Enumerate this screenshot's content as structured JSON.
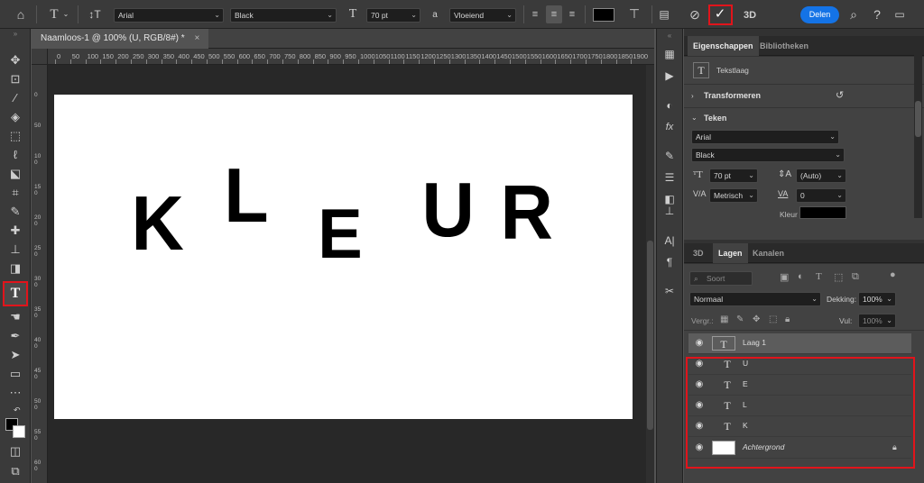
{
  "options_bar": {
    "font_family": "Arial",
    "font_style": "Black",
    "font_size": "70 pt",
    "aa_label": "a",
    "anti_alias": "Vloeiend",
    "text_color": "#000000",
    "threed_label": "3D",
    "share_label": "Delen"
  },
  "document": {
    "tab_title": "Naamloos-1 @ 100% (U, RGB/8#) *",
    "close_glyph": "×",
    "ruler_h": [
      "0",
      "50",
      "100",
      "150",
      "200",
      "250",
      "300",
      "350",
      "400",
      "450",
      "500",
      "550",
      "600",
      "650",
      "700",
      "750",
      "800",
      "850",
      "900",
      "950",
      "1000",
      "1050",
      "1100",
      "1150",
      "1200",
      "1250",
      "1300",
      "1350",
      "1400",
      "1450",
      "1500",
      "1550",
      "1600",
      "1650",
      "1700",
      "1750",
      "1800",
      "1850",
      "1900"
    ],
    "ruler_v": [
      "0",
      "50",
      "100",
      "150",
      "200",
      "250",
      "300",
      "350",
      "400",
      "450",
      "500",
      "550",
      "600",
      "650",
      "700",
      "750",
      "800",
      "850",
      "900",
      "950",
      "1000"
    ],
    "letters": [
      "K",
      "L",
      "E",
      "U",
      "R"
    ]
  },
  "properties": {
    "tabs": [
      "Eigenschappen",
      "Bibliotheken"
    ],
    "layer_type": "Tekstlaag",
    "transform_label": "Transformeren",
    "teken_label": "Teken",
    "font_family": "Arial",
    "font_style": "Black",
    "size": "70 pt",
    "leading": "(Auto)",
    "kerning": "Metrisch",
    "tracking": "0",
    "color_label": "Kleur",
    "color": "#000000"
  },
  "layers_panel": {
    "tabs": [
      "3D",
      "Lagen",
      "Kanalen"
    ],
    "search_placeholder": "Soort",
    "blend_mode": "Normaal",
    "opacity_label": "Dekking:",
    "opacity": "100%",
    "lock_label": "Vergr.:",
    "fill_label": "Vul:",
    "fill": "100%",
    "layers": [
      {
        "name": "Laag 1",
        "type": "text",
        "selected": true
      },
      {
        "name": "U",
        "type": "text",
        "selected": false
      },
      {
        "name": "E",
        "type": "text",
        "selected": false
      },
      {
        "name": "L",
        "type": "text",
        "selected": false
      },
      {
        "name": "K",
        "type": "text",
        "selected": false
      },
      {
        "name": "Achtergrond",
        "type": "background",
        "selected": false
      }
    ]
  },
  "colors": {
    "highlight": "#e1141b",
    "share": "#1473e6"
  }
}
